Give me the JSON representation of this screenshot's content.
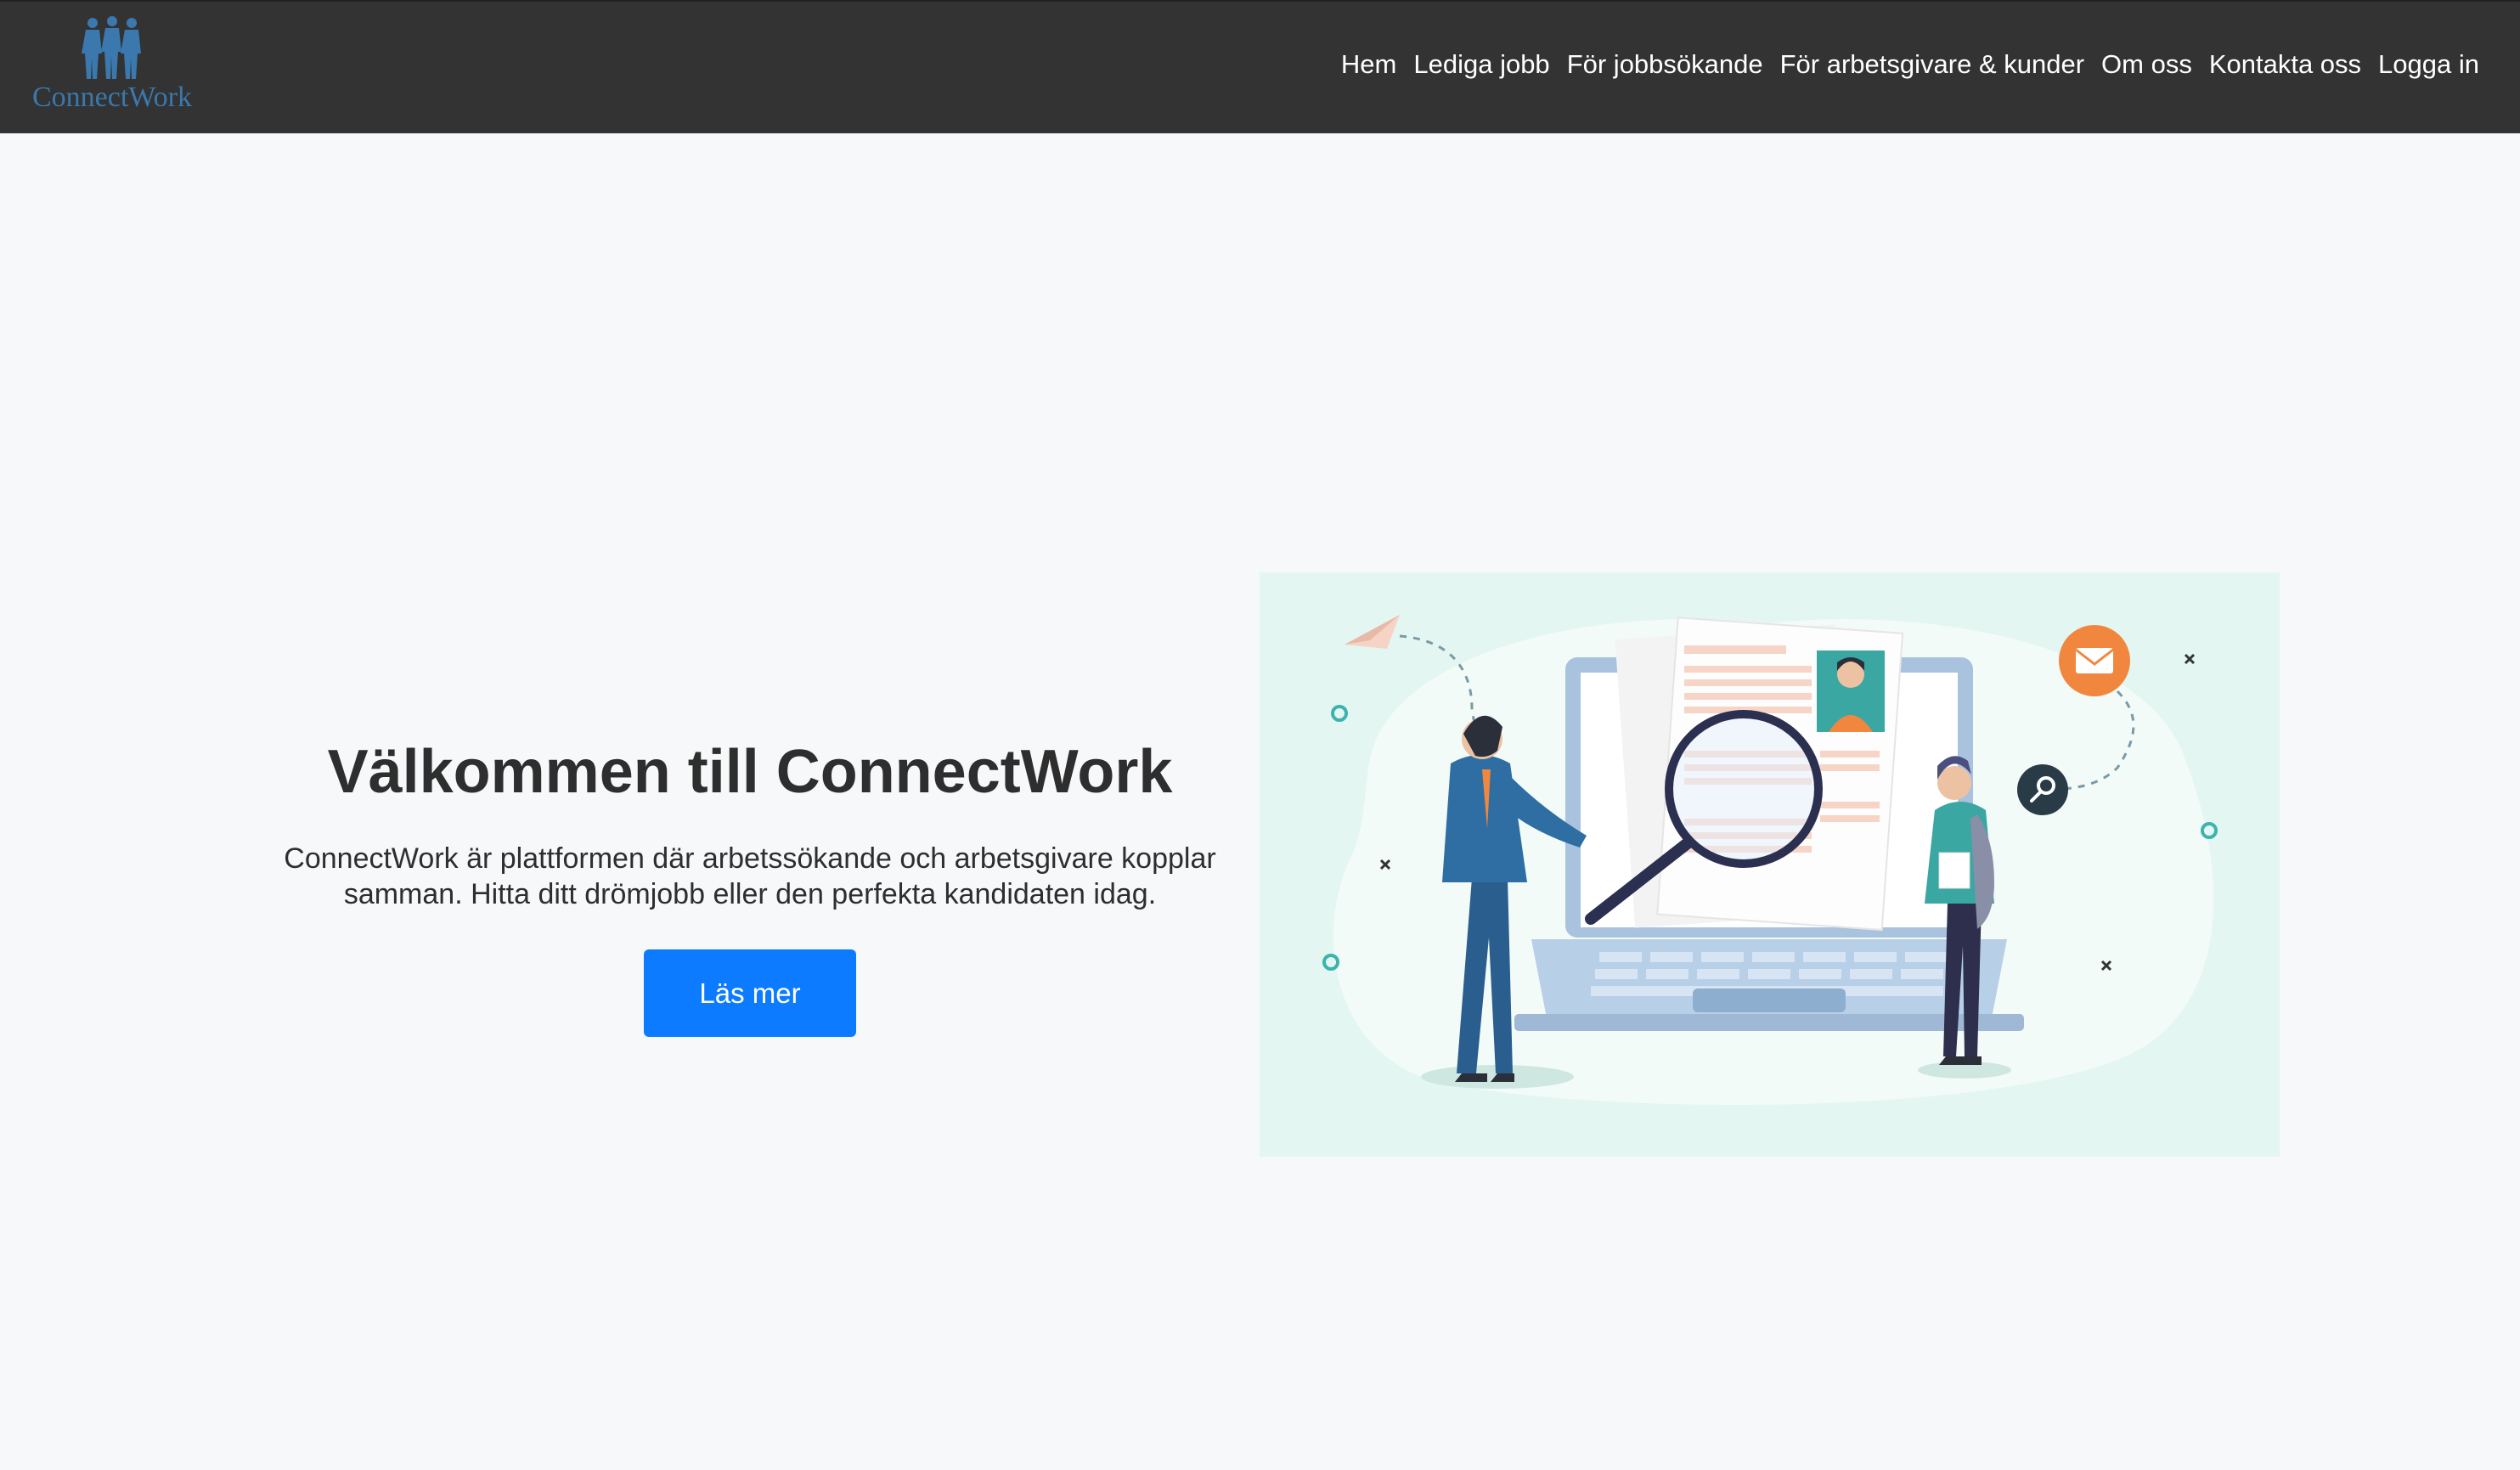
{
  "brand": {
    "name": "ConnectWork",
    "logo_color": "#3a78ad"
  },
  "nav": {
    "items": [
      "Hem",
      "Lediga jobb",
      "För jobbsökande",
      "För arbetsgivare & kunder",
      "Om oss",
      "Kontakta oss",
      "Logga in"
    ],
    "background": "#333333"
  },
  "hero": {
    "title": "Välkommen till ConnectWork",
    "description": "ConnectWork är plattformen där arbetssökande och arbetsgivare kopplar samman. Hitta ditt drömjobb eller den perfekta kandidaten idag.",
    "button_label": "Läs mer",
    "button_color": "#0d7bff"
  },
  "illustration": {
    "icons": [
      "paper-plane-icon",
      "magnifier-icon",
      "envelope-icon",
      "key-icon"
    ],
    "background": "#e3f6f1"
  }
}
